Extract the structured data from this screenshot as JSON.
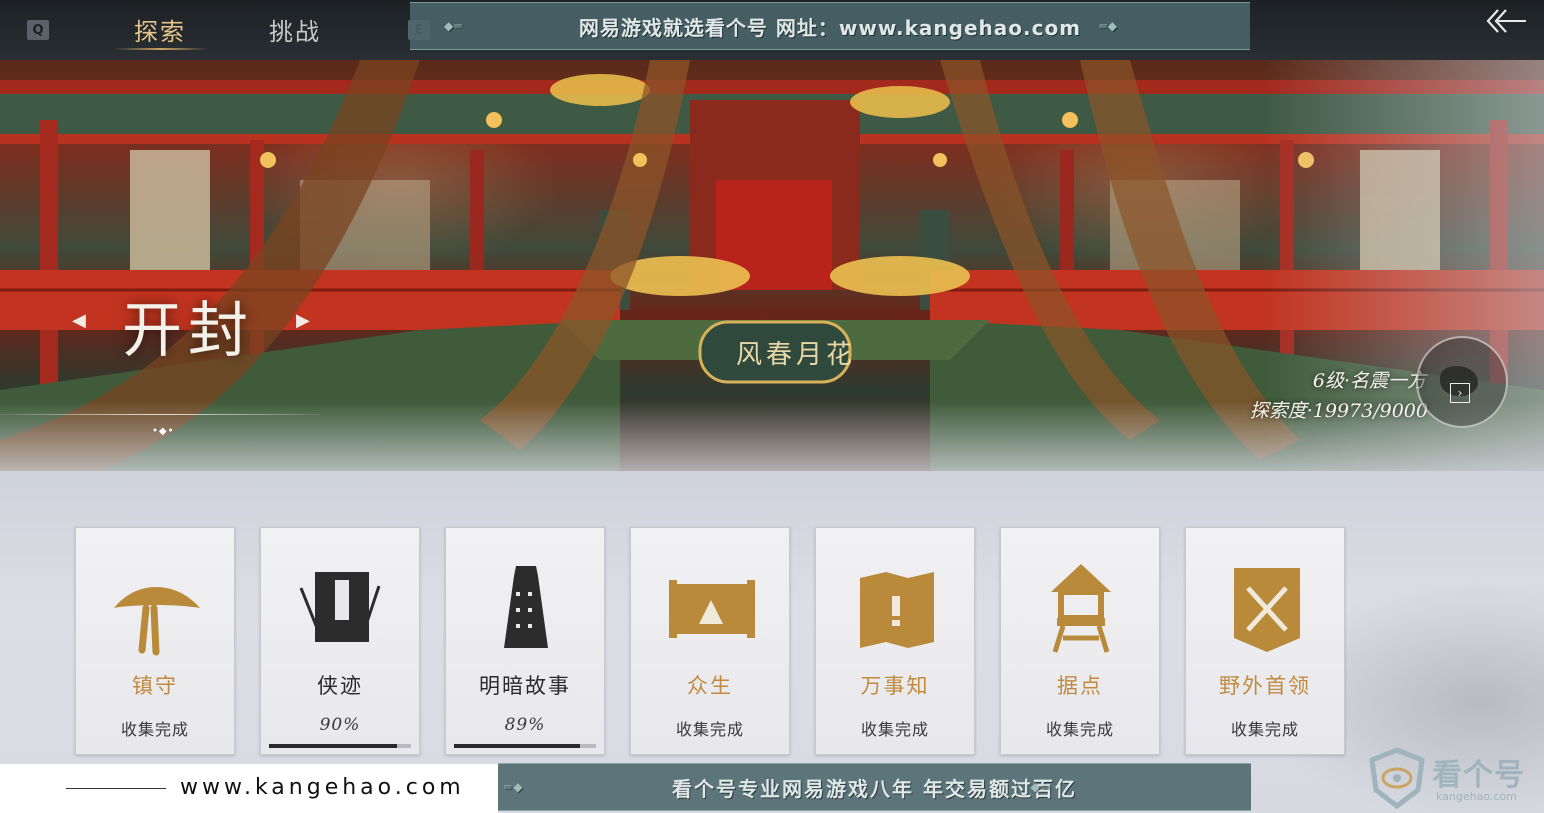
{
  "topbar": {
    "key_left": "Q",
    "key_right": "E",
    "tabs": [
      {
        "label": "探索",
        "active": true
      },
      {
        "label": "挑战",
        "active": false
      }
    ]
  },
  "watermark": {
    "top_banner": "网易游戏就选看个号  网址：www.kangehao.com",
    "bottom_banner": "看个号专业网易游戏八年  年交易额过百亿",
    "footer_url": "www.kangehao.com",
    "logo_name": "看个号",
    "logo_sub": "kangehao.com"
  },
  "hero": {
    "city_name": "开封",
    "signboard": "风春月花",
    "level": "6级·名震一方",
    "exploration": "探索度·19973/9000"
  },
  "cards": [
    {
      "title": "镇守",
      "status": "收集完成",
      "icon": "straw-hat-icon",
      "style": "gold",
      "progress": null
    },
    {
      "title": "侠迹",
      "status": "90%",
      "icon": "book-bamboo-icon",
      "style": "dark",
      "progress": 0.9
    },
    {
      "title": "明暗故事",
      "status": "89%",
      "icon": "bell-icon",
      "style": "dark",
      "progress": 0.89
    },
    {
      "title": "众生",
      "status": "收集完成",
      "icon": "scroll-painting-icon",
      "style": "gold",
      "progress": null
    },
    {
      "title": "万事知",
      "status": "收集完成",
      "icon": "folding-map-icon",
      "style": "gold",
      "progress": null
    },
    {
      "title": "据点",
      "status": "收集完成",
      "icon": "watchtower-icon",
      "style": "gold",
      "progress": null
    },
    {
      "title": "野外首领",
      "status": "收集完成",
      "icon": "crossed-swords-banner-icon",
      "style": "gold",
      "progress": null
    }
  ],
  "colors": {
    "gold": "#c08a3e",
    "tab_active": "#e6c58a",
    "banner": "#4a676c"
  }
}
